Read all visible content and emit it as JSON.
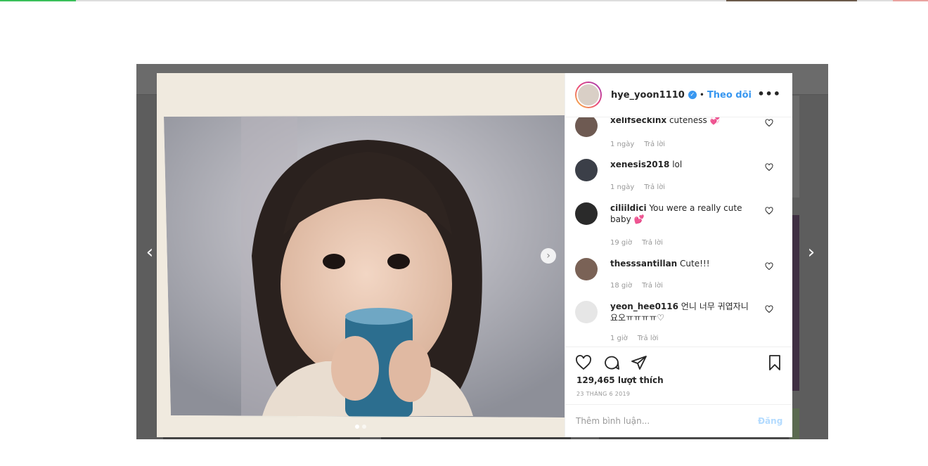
{
  "post": {
    "username": "hye_yoon1110",
    "verified_symbol": "✓",
    "separator": "•",
    "follow_label": "Theo dõi",
    "more_label": "•••",
    "next_symbol": "›"
  },
  "nav": {
    "prev_symbol": "‹",
    "next_symbol": "›"
  },
  "comments": [
    {
      "user": "xelifseckinx",
      "text": "cuteness 💞",
      "time": "1 ngày",
      "reply": "Trả lời",
      "avatar_color": "#6e5a52"
    },
    {
      "user": "xenesis2018",
      "text": "lol",
      "time": "1 ngày",
      "reply": "Trả lời",
      "avatar_color": "#3b3f48"
    },
    {
      "user": "ciliildici",
      "text": "You were a really cute baby 💕",
      "time": "19 giờ",
      "reply": "Trả lời",
      "avatar_color": "#2a2a2a"
    },
    {
      "user": "thesssantillan",
      "text": "Cute!!!",
      "time": "18 giờ",
      "reply": "Trả lời",
      "avatar_color": "#7a6256"
    },
    {
      "user": "yeon_hee0116",
      "text": "언니 너무 귀엽자니요오ㅠㅠㅠㅠ♡",
      "time": "1 giờ",
      "reply": "Trả lời",
      "avatar_color": "#e6e6e6"
    }
  ],
  "actions": {
    "likes": "129,465 lượt thích",
    "date": "23 THÁNG 6 2019"
  },
  "add_comment": {
    "placeholder": "Thêm bình luận...",
    "post_label": "Đăng"
  }
}
